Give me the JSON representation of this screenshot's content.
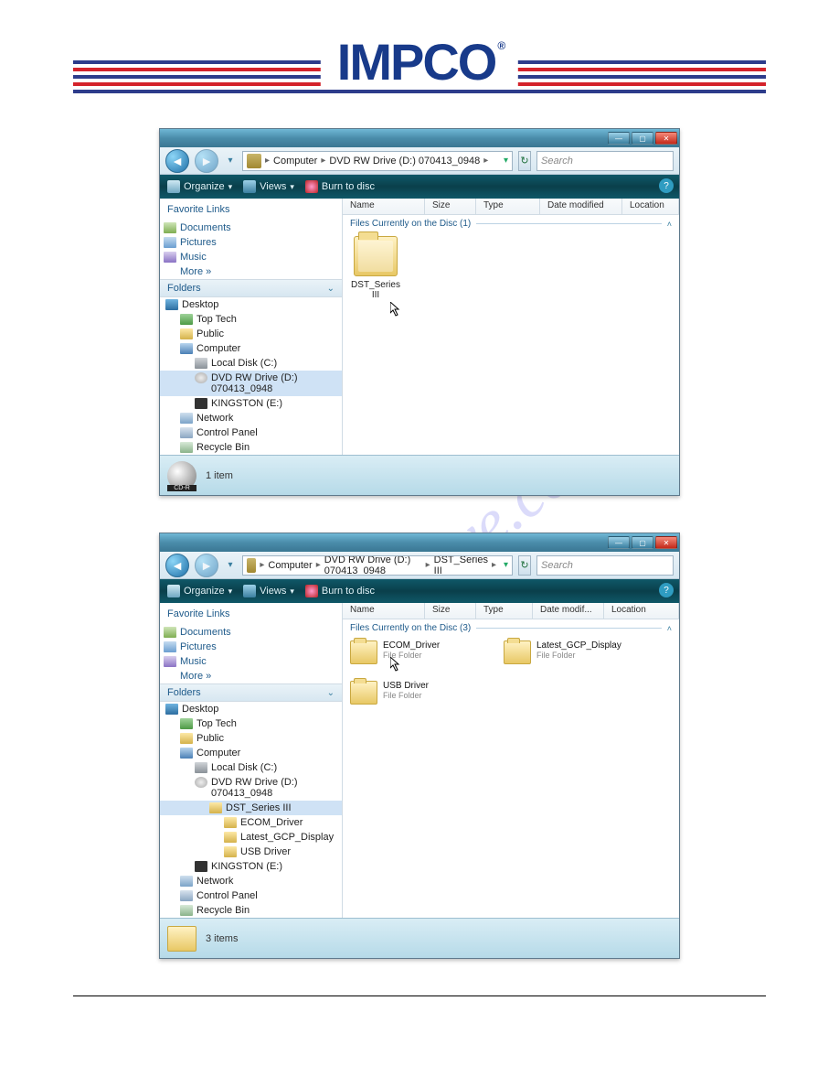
{
  "brand": {
    "name": "IMPCO",
    "registered": "®"
  },
  "watermark": "manualshive.com",
  "win1": {
    "breadcrumbs": [
      "Computer",
      "DVD RW Drive (D:) 070413_0948"
    ],
    "search_placeholder": "Search",
    "toolbar": {
      "organize": "Organize",
      "views": "Views",
      "burn": "Burn to disc"
    },
    "side": {
      "fav_hdr": "Favorite Links",
      "favs": [
        "Documents",
        "Pictures",
        "Music"
      ],
      "more": "More",
      "folders_hdr": "Folders",
      "tree": {
        "desktop": "Desktop",
        "toptech": "Top Tech",
        "public": "Public",
        "computer": "Computer",
        "local": "Local Disk (C:)",
        "dvd": "DVD RW Drive (D:) 070413_0948",
        "kingston": "KINGSTON (E:)",
        "network": "Network",
        "cpl": "Control Panel",
        "bin": "Recycle Bin"
      }
    },
    "cols": [
      "Name",
      "Size",
      "Type",
      "Date modified",
      "Location"
    ],
    "group": "Files Currently on the Disc (1)",
    "item1": "DST_Series III",
    "status": "1 item"
  },
  "win2": {
    "breadcrumbs": [
      "Computer",
      "DVD RW Drive (D:) 070413_0948",
      "DST_Series III"
    ],
    "search_placeholder": "Search",
    "toolbar": {
      "organize": "Organize",
      "views": "Views",
      "burn": "Burn to disc"
    },
    "side": {
      "fav_hdr": "Favorite Links",
      "favs": [
        "Documents",
        "Pictures",
        "Music"
      ],
      "more": "More",
      "folders_hdr": "Folders",
      "tree": {
        "desktop": "Desktop",
        "toptech": "Top Tech",
        "public": "Public",
        "computer": "Computer",
        "local": "Local Disk (C:)",
        "dvd": "DVD RW Drive (D:) 070413_0948",
        "dst": "DST_Series III",
        "ecom": "ECOM_Driver",
        "gcp": "Latest_GCP_Display",
        "usb": "USB Driver",
        "kingston": "KINGSTON (E:)",
        "network": "Network",
        "cpl": "Control Panel",
        "bin": "Recycle Bin"
      }
    },
    "cols": [
      "Name",
      "Size",
      "Type",
      "Date modif...",
      "Location"
    ],
    "group": "Files Currently on the Disc (3)",
    "items": [
      {
        "name": "ECOM_Driver",
        "type": "File Folder"
      },
      {
        "name": "Latest_GCP_Display",
        "type": "File Folder"
      },
      {
        "name": "USB Driver",
        "type": "File Folder"
      }
    ],
    "status": "3 items"
  }
}
